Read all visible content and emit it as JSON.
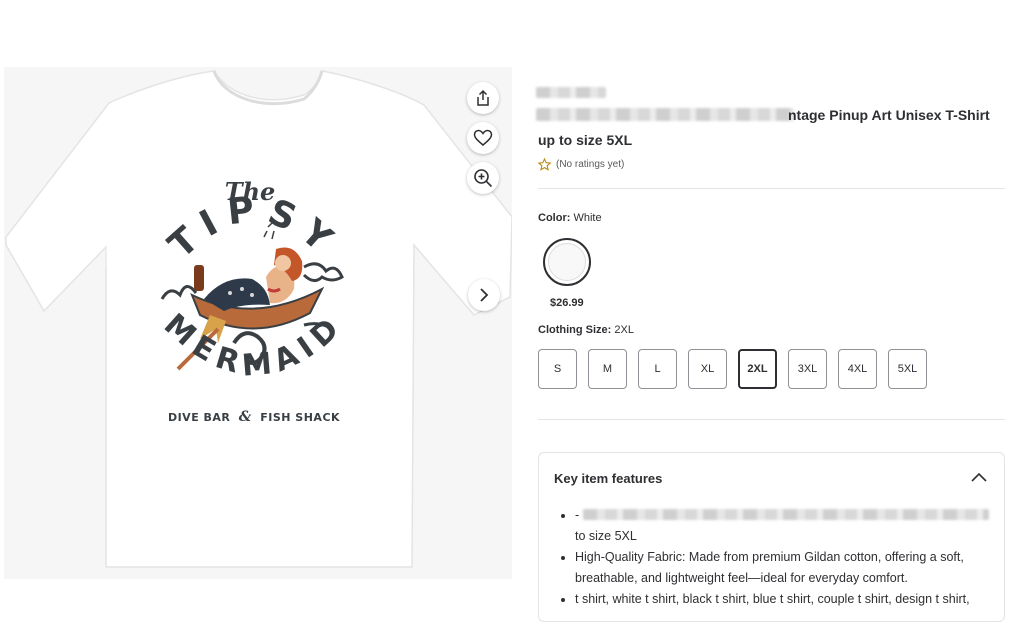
{
  "product": {
    "title_line1_visible": "ntage Pinup Art Unisex T-Shirt",
    "title_line2": "up to size 5XL",
    "rating_text": "(No ratings yet)"
  },
  "print": {
    "top_word": "The",
    "arc_word": "TIPSY",
    "bottom_word": "MERMAID",
    "tagline_left": "DIVE BAR",
    "tagline_amp": "&",
    "tagline_right": "FISH SHACK"
  },
  "actions": {
    "share_icon": "share-icon",
    "favorite_icon": "heart-icon",
    "zoom_icon": "zoom-in-icon",
    "next_icon": "chevron-right-icon"
  },
  "color": {
    "label": "Color:",
    "value": "White",
    "swatch_price": "$26.99"
  },
  "size": {
    "label": "Clothing Size:",
    "value": "2XL",
    "options": [
      "S",
      "M",
      "L",
      "XL",
      "2XL",
      "3XL",
      "4XL",
      "5XL"
    ],
    "selected": "2XL"
  },
  "features": {
    "heading": "Key item features",
    "items": [
      {
        "prefix": "-",
        "text": "to size 5XL"
      },
      {
        "text": "High-Quality Fabric: Made from premium Gildan cotton, offering a soft, breathable, and lightweight feel—ideal for everyday comfort."
      },
      {
        "text": "t shirt, white t shirt, black t shirt, blue t shirt, couple t shirt, design t shirt,"
      }
    ]
  },
  "colors": {
    "text": "#2e2f32",
    "divider": "#e3e4e5",
    "rating_star": "#b8860b"
  }
}
